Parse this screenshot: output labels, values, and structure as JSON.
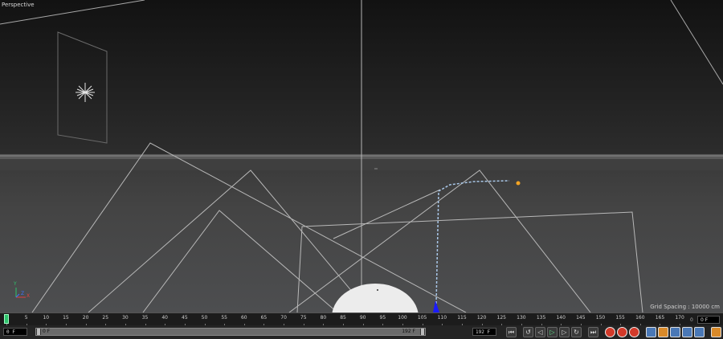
{
  "viewport": {
    "label": "Perspective",
    "grid_spacing": "Grid Spacing : 10000 cm",
    "axis_labels": [
      "Y",
      "Z",
      "X"
    ]
  },
  "timeline": {
    "ticks": [
      "0",
      "5",
      "10",
      "15",
      "20",
      "25",
      "30",
      "35",
      "40",
      "45",
      "50",
      "55",
      "60",
      "65",
      "70",
      "75",
      "80",
      "85",
      "90",
      "95",
      "100",
      "105",
      "110",
      "115",
      "120",
      "125",
      "130",
      "135",
      "140",
      "145",
      "150",
      "155",
      "160",
      "165",
      "170"
    ],
    "current_frame": "0 F",
    "current_frame_label": "0"
  },
  "transport": {
    "start_field": "0 F",
    "range_start": "0 F",
    "range_end": "192 F",
    "end_field": "192 F",
    "buttons": {
      "go_start": "⏮",
      "prev_key": "↺",
      "prev_frame": "◁",
      "play": "▷",
      "next_frame": "▷",
      "next_key": "↻",
      "go_end": "⏭"
    }
  },
  "colors": {
    "viewport_top": "#121212",
    "viewport_bottom": "#4d4e50",
    "playhead": "#2ec36b",
    "selected_axis": "#1b1bff",
    "light_point": "#f3a424",
    "record_red": "#d23a2a",
    "snap_blue": "#4a78b6"
  },
  "icons": {
    "record": "record-icon",
    "autokey": "autokey-icon",
    "keyframe_help": "keyframe-help-icon",
    "move": "move-icon",
    "scale": "scale-icon",
    "rotate": "rotate-icon",
    "param": "param-icon",
    "layout": "layout-icon"
  }
}
